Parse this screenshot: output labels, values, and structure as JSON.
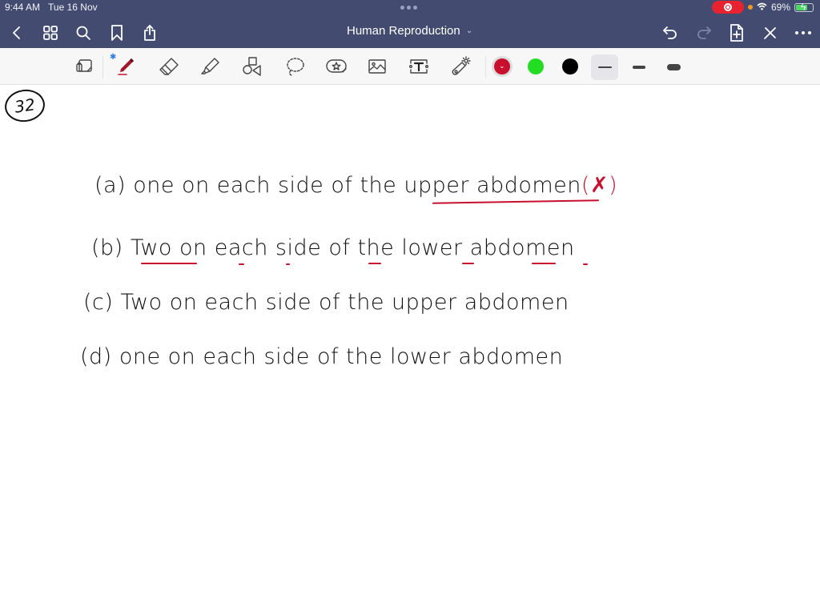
{
  "status_bar": {
    "time": "9:44 AM",
    "date": "Tue 16 Nov",
    "battery": "69%",
    "battery_level_percent": 69,
    "charging": true,
    "recording": true
  },
  "header": {
    "title": "Human Reproduction",
    "left_icons": [
      "back-icon",
      "grid-icon",
      "search-icon",
      "bookmark-icon",
      "share-icon"
    ],
    "right_icons": [
      "undo-icon",
      "redo-icon",
      "add-page-icon",
      "close-pen-icon",
      "more-icon"
    ]
  },
  "toolbar": {
    "tools": [
      "page-reader",
      "pen",
      "eraser",
      "highlighter",
      "shapes",
      "lasso",
      "elements",
      "image",
      "text",
      "laser-pointer"
    ],
    "selected_tool": "pen",
    "colors": [
      {
        "name": "red",
        "hex": "#c8102e",
        "selected": true
      },
      {
        "name": "green",
        "hex": "#22dd22",
        "selected": false
      },
      {
        "name": "black",
        "hex": "#000000",
        "selected": false
      }
    ],
    "stroke_sizes": [
      "thin",
      "medium",
      "thick"
    ],
    "selected_stroke": "thin"
  },
  "note": {
    "question_number": "32",
    "options": [
      {
        "label": "(a)",
        "text": "one on each side of the upper abdomen",
        "mark": "(✗)"
      },
      {
        "label": "(b)",
        "text": "Two on each side of the lower abdomen",
        "mark": ""
      },
      {
        "label": "(c)",
        "text": "Two on each side of the upper abdomen",
        "mark": ""
      },
      {
        "label": "(d)",
        "text": "one on each side of the lower abdomen",
        "mark": ""
      }
    ],
    "ink_colors": {
      "text": "#111111",
      "annotation": "#c8102e"
    }
  }
}
